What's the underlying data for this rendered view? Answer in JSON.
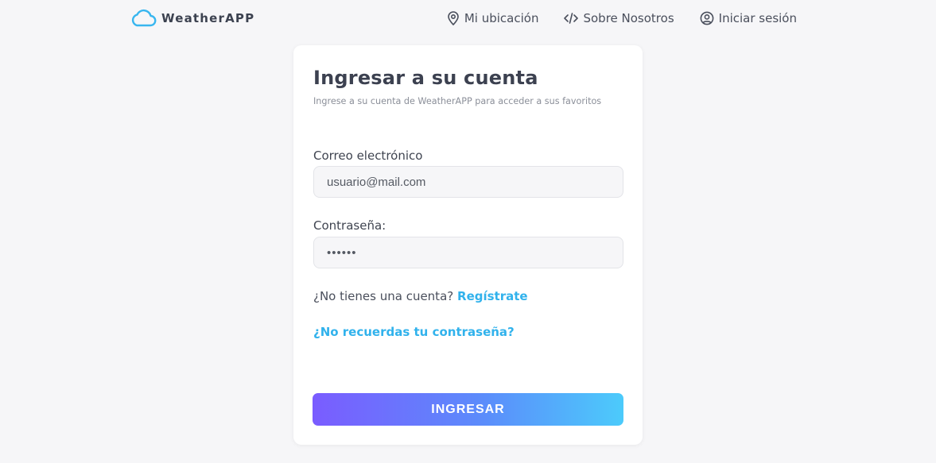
{
  "nav": {
    "brand": "WeatherAPP",
    "brand_icon": "cloud-icon",
    "links": [
      {
        "label": "Mi ubicación",
        "icon": "location-pin-icon"
      },
      {
        "label": "Sobre Nosotros",
        "icon": "code-icon"
      },
      {
        "label": "Iniciar sesión",
        "icon": "user-circle-icon"
      }
    ]
  },
  "login": {
    "title": "Ingresar a su cuenta",
    "subtitle": "Ingrese a su cuenta de WeatherAPP para acceder a sus favoritos",
    "email_label": "Correo electrónico",
    "email_value": "usuario@mail.com",
    "password_label": "Contraseña:",
    "password_value": "••••••",
    "signup_prompt": "¿No tienes una cuenta?",
    "signup_link": "Regístrate",
    "forgot_link": "¿No recuerdas tu contraseña?",
    "submit_label": "INGRESAR"
  },
  "colors": {
    "accent": "#31b2ec",
    "gradient_start": "#7a5cff",
    "gradient_end": "#4ccbfb",
    "background": "#f6f6f8"
  }
}
